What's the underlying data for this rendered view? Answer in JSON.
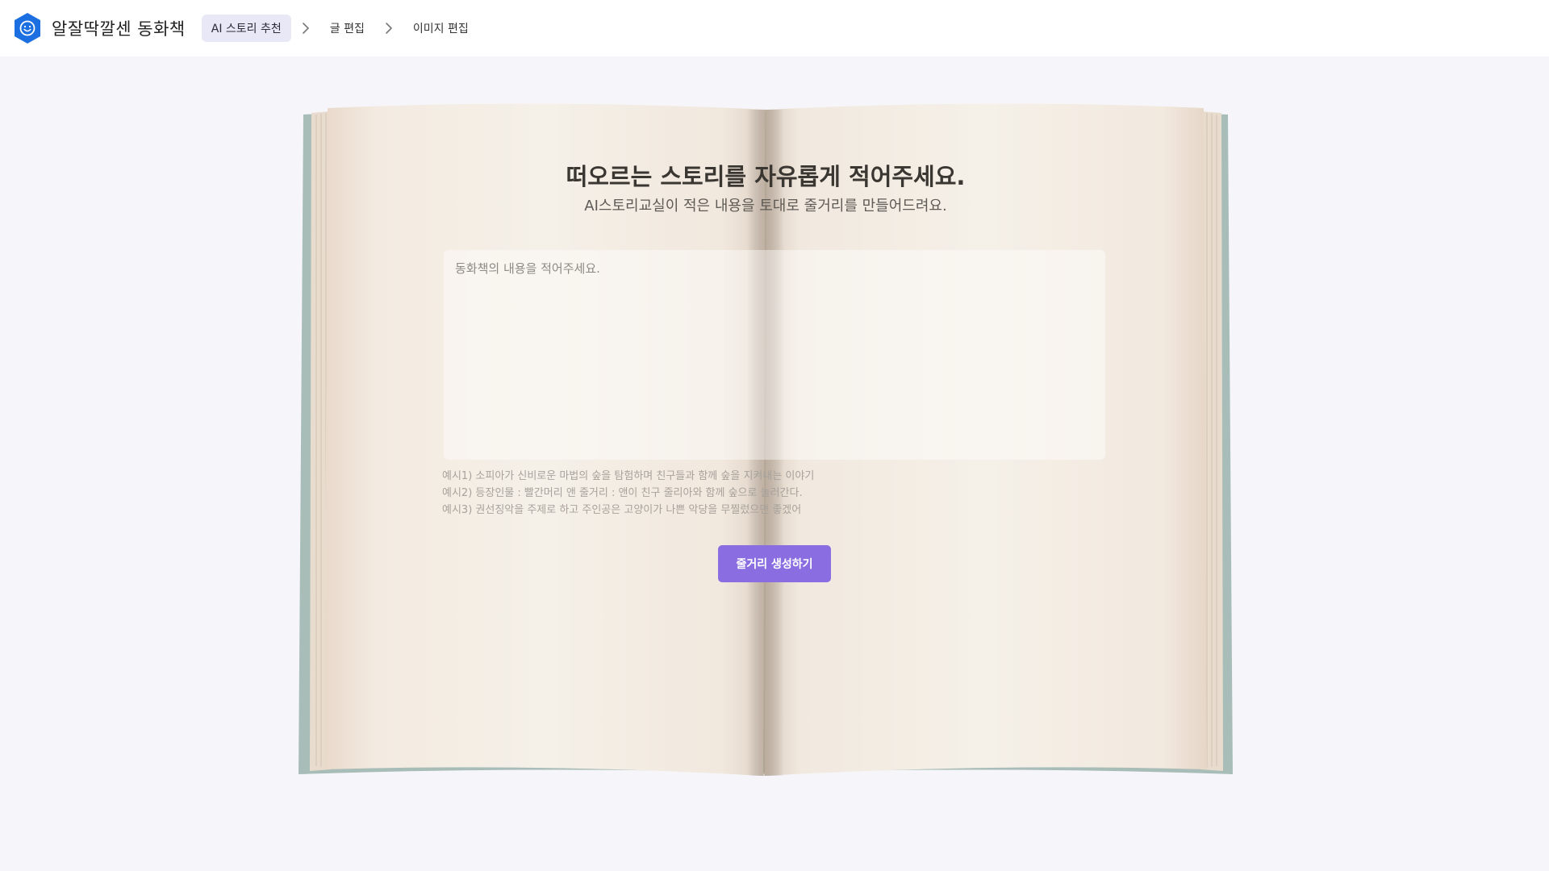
{
  "app": {
    "brand_name": "알잘딱깔센 동화책"
  },
  "steps": [
    {
      "label": "AI 스토리 추천",
      "active": true
    },
    {
      "label": "글 편집",
      "active": false
    },
    {
      "label": "이미지 편집",
      "active": false
    }
  ],
  "main": {
    "headline": "떠오르는 스토리를 자유롭게 적어주세요.",
    "subline": "AI스토리교실이 적은 내용을 토대로 줄거리를 만들어드려요.",
    "story_input": {
      "value": "",
      "placeholder": "동화책의 내용을 적어주세요."
    },
    "examples": [
      "예시1) 소피아가 신비로운 마법의 숲을 탐험하며 친구들과 함께 숲을 지켜내는 이야기",
      "예시2) 등장인물 : 빨간머리 앤 줄거리 : 앤이 친구 줄리아와 함께 숲으로 놀러간다.",
      "예시3) 권선징악을 주제로 하고 주인공은 고양이가 나쁜 악당을 무찔렀으면 좋겠어"
    ],
    "generate_button_label": "줄거리 생성하기"
  },
  "colors": {
    "accent": "#8a6de0",
    "brand": "#1c6fe0",
    "active_step_bg": "#e8e8f6",
    "page_bg": "#f6f6fa"
  },
  "icons": {
    "logo": "smiley-hexagon-icon",
    "separator": "chevron-right-icon"
  }
}
